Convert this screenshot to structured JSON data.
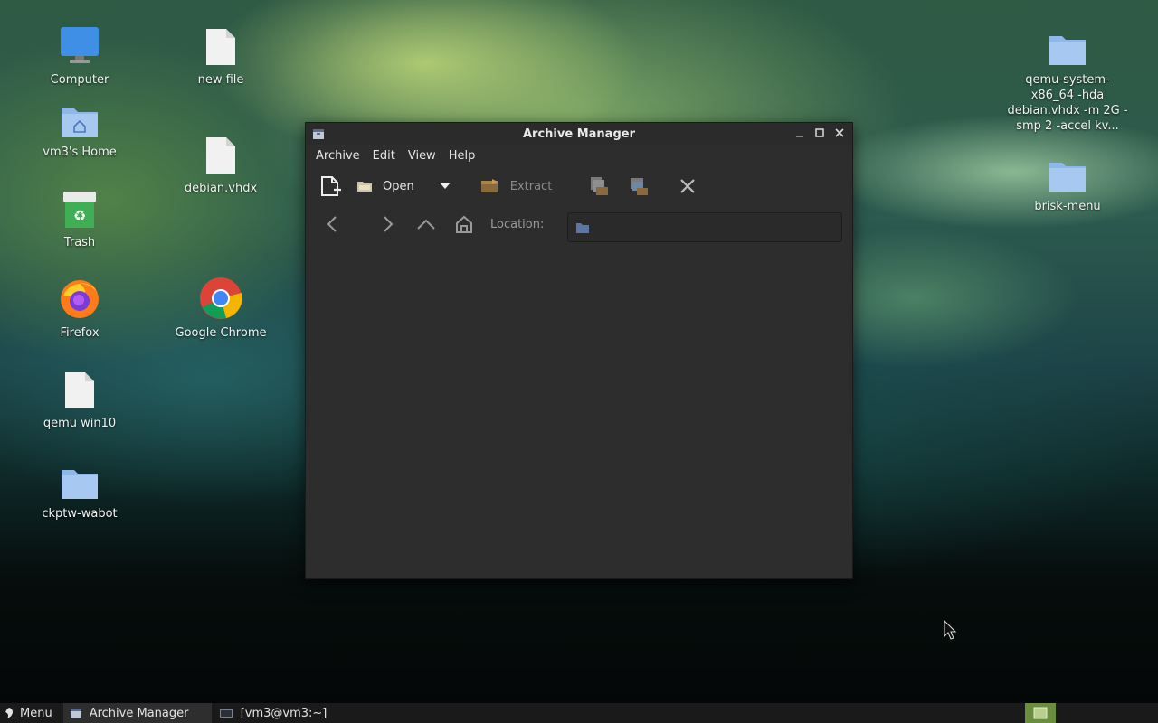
{
  "desktop": {
    "icons": [
      {
        "label": "Computer",
        "icon": "computer-icon"
      },
      {
        "label": "new file",
        "icon": "file-icon"
      },
      {
        "label": "vm3's Home",
        "icon": "home-folder-icon"
      },
      {
        "label": "debian.vhdx",
        "icon": "file-icon"
      },
      {
        "label": "Trash",
        "icon": "trash-icon"
      },
      {
        "label": "Firefox",
        "icon": "firefox-icon"
      },
      {
        "label": "Google Chrome",
        "icon": "chrome-icon"
      },
      {
        "label": "qemu win10",
        "icon": "file-icon"
      },
      {
        "label": "ckptw-wabot",
        "icon": "folder-icon"
      },
      {
        "label": "qemu-system-x86_64 -hda debian.vhdx -m 2G -smp 2 -accel kv...",
        "icon": "folder-icon"
      },
      {
        "label": "brisk-menu",
        "icon": "folder-icon"
      }
    ]
  },
  "window": {
    "title": "Archive Manager",
    "menu": [
      "Archive",
      "Edit",
      "View",
      "Help"
    ],
    "toolbar": {
      "new_icon": "new-archive-icon",
      "open_label": "Open",
      "extract_label": "Extract"
    },
    "navbar": {
      "location_label": "Location:",
      "location_value": ""
    }
  },
  "taskbar": {
    "menu_label": "Menu",
    "tasks": [
      "Archive Manager",
      "[vm3@vm3:~]"
    ]
  },
  "colors": {
    "window_bg": "#2d2d2d",
    "taskbar_bg": "#1a1a1a",
    "folder_blue": "#8fb8ea",
    "tray_green": "#6b8d3e"
  }
}
